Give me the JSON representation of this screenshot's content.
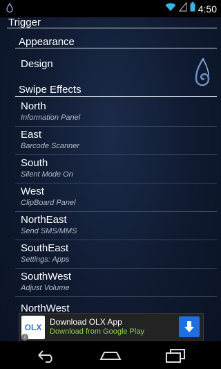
{
  "status": {
    "time": "4:50",
    "app_icon": "droplet-icon",
    "wifi_icon": "wifi-icon",
    "signal_icon": "signal-icon",
    "battery_icon": "battery-icon"
  },
  "header": {
    "title": "Trigger"
  },
  "appearance": {
    "title": "Appearance",
    "design_label": "Design",
    "design_icon": "trigger-logo-icon"
  },
  "swipe_effects": {
    "title": "Swipe Effects",
    "items": [
      {
        "title": "North",
        "summary": "Information Panel"
      },
      {
        "title": "East",
        "summary": "Barcode Scanner"
      },
      {
        "title": "South",
        "summary": "Silent Mode On"
      },
      {
        "title": "West",
        "summary": "ClipBoard Panel"
      },
      {
        "title": "NorthEast",
        "summary": "Send SMS/MMS"
      },
      {
        "title": "SouthEast",
        "summary": "Settings: Apps"
      },
      {
        "title": "SouthWest",
        "summary": "Adjust Volume"
      },
      {
        "title": "NorthWest",
        "summary": ""
      }
    ]
  },
  "ad": {
    "logo_text": "OLX",
    "title": "Download OLX App",
    "subtitle": "Download from Google Play",
    "colors": {
      "subtitle": "#8fd14f",
      "download": "#1e6fe0"
    }
  },
  "navbar": {
    "back_icon": "back-icon",
    "home_icon": "home-icon",
    "recents_icon": "recents-icon"
  }
}
